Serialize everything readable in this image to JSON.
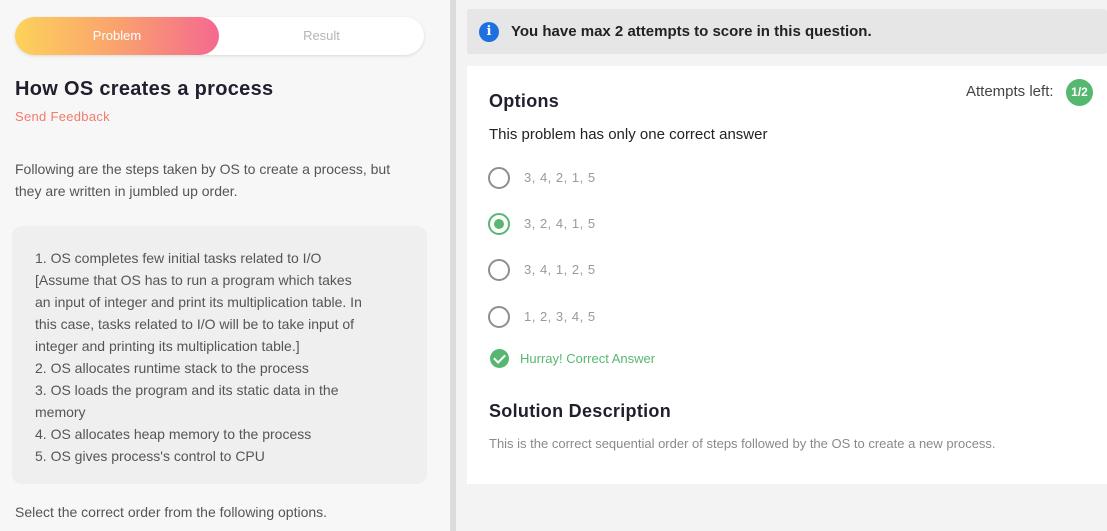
{
  "tabs": {
    "problem": "Problem",
    "result": "Result"
  },
  "problem": {
    "title": "How OS creates a process",
    "feedback": "Send Feedback",
    "intro": "Following are the steps taken by OS to create a process, but they are written in jumbled up order.",
    "steps": [
      "1. OS completes few initial tasks related to I/O",
      "[Assume that OS has to run a program which takes",
      "an input of integer and print its multiplication table. In",
      "this case, tasks related to I/O will be to take input of",
      "integer and printing its multiplication table.]",
      "2. OS allocates runtime stack to the process",
      "3. OS loads the program and its static data in the",
      "memory",
      "4. OS allocates heap memory to the process",
      "5. OS gives process's control to CPU"
    ],
    "select_text": "Select the correct order from the following options."
  },
  "banner": {
    "icon": "info-icon",
    "text": "You have max 2 attempts to score in this question."
  },
  "options_panel": {
    "title": "Options",
    "attempts_label": "Attempts left:",
    "attempts_value": "1/2",
    "note": "This problem has only one correct answer",
    "options": [
      {
        "label": "3, 4, 2, 1, 5",
        "selected": false
      },
      {
        "label": "3, 2, 4, 1, 5",
        "selected": true
      },
      {
        "label": "3, 4, 1, 2, 5",
        "selected": false
      },
      {
        "label": "1, 2, 3, 4, 5",
        "selected": false
      }
    ],
    "result_text": "Hurray! Correct Answer"
  },
  "solution": {
    "title": "Solution Description",
    "text": "This is the correct sequential order of steps followed by the OS to create a new process."
  },
  "colors": {
    "accent_green": "#56b870",
    "feedback": "#f37b6c",
    "info_blue": "#1e6fe0"
  }
}
